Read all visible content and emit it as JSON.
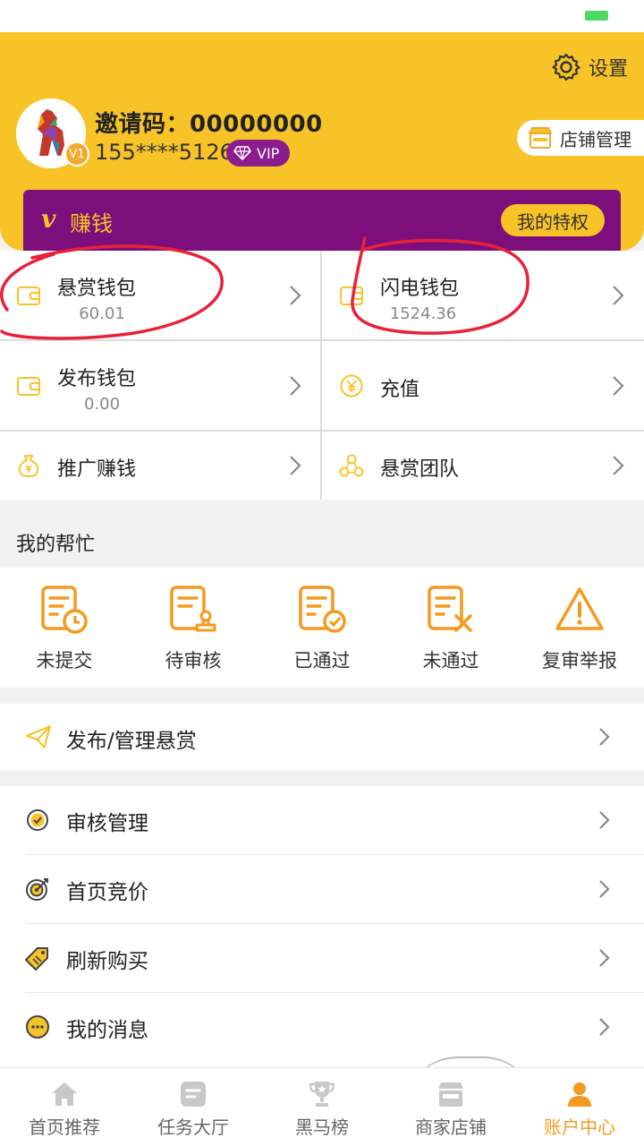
{
  "header": {
    "settings_label": "设置",
    "invite_code": "邀请码：00000000",
    "phone": "155****5126",
    "vip_label": "VIP",
    "level_badge": "V1",
    "store_manage": "店铺管理",
    "earn_v": "v",
    "earn_label": "赚钱",
    "privilege": "我的特权"
  },
  "wallets": [
    {
      "label": "悬赏钱包",
      "value": "60.01",
      "icon": "wallet-icon"
    },
    {
      "label": "闪电钱包",
      "value": "1524.36",
      "icon": "wallet-icon"
    },
    {
      "label": "发布钱包",
      "value": "0.00",
      "icon": "wallet-icon"
    },
    {
      "label": "充值",
      "value": "",
      "icon": "yen-coin-icon"
    },
    {
      "label": "推广赚钱",
      "value": "",
      "icon": "money-bag-icon"
    },
    {
      "label": "悬赏团队",
      "value": "",
      "icon": "team-icon"
    }
  ],
  "help": {
    "title": "我的帮忙",
    "items": [
      {
        "label": "未提交",
        "icon": "doc-clock-icon"
      },
      {
        "label": "待审核",
        "icon": "doc-stamp-icon"
      },
      {
        "label": "已通过",
        "icon": "doc-check-icon"
      },
      {
        "label": "未通过",
        "icon": "doc-x-icon"
      },
      {
        "label": "复审举报",
        "icon": "warning-icon"
      }
    ]
  },
  "menu": {
    "publish": "发布/管理悬赏",
    "items": [
      {
        "label": "审核管理",
        "icon": "check-circle-icon"
      },
      {
        "label": "首页竞价",
        "icon": "target-icon"
      },
      {
        "label": "刷新购买",
        "icon": "tag-icon"
      },
      {
        "label": "我的消息",
        "icon": "message-icon"
      }
    ]
  },
  "tabs": [
    {
      "label": "首页推荐",
      "icon": "home-icon",
      "active": false
    },
    {
      "label": "任务大厅",
      "icon": "task-icon",
      "active": false
    },
    {
      "label": "黑马榜",
      "icon": "trophy-icon",
      "active": false
    },
    {
      "label": "商家店铺",
      "icon": "shop-icon",
      "active": false
    },
    {
      "label": "账户中心",
      "icon": "user-icon",
      "active": true
    }
  ],
  "colors": {
    "brand_yellow": "#f7c327",
    "purple": "#7d0f7c",
    "accent_orange": "#f49a1e",
    "annotation_red": "#e8213a"
  }
}
